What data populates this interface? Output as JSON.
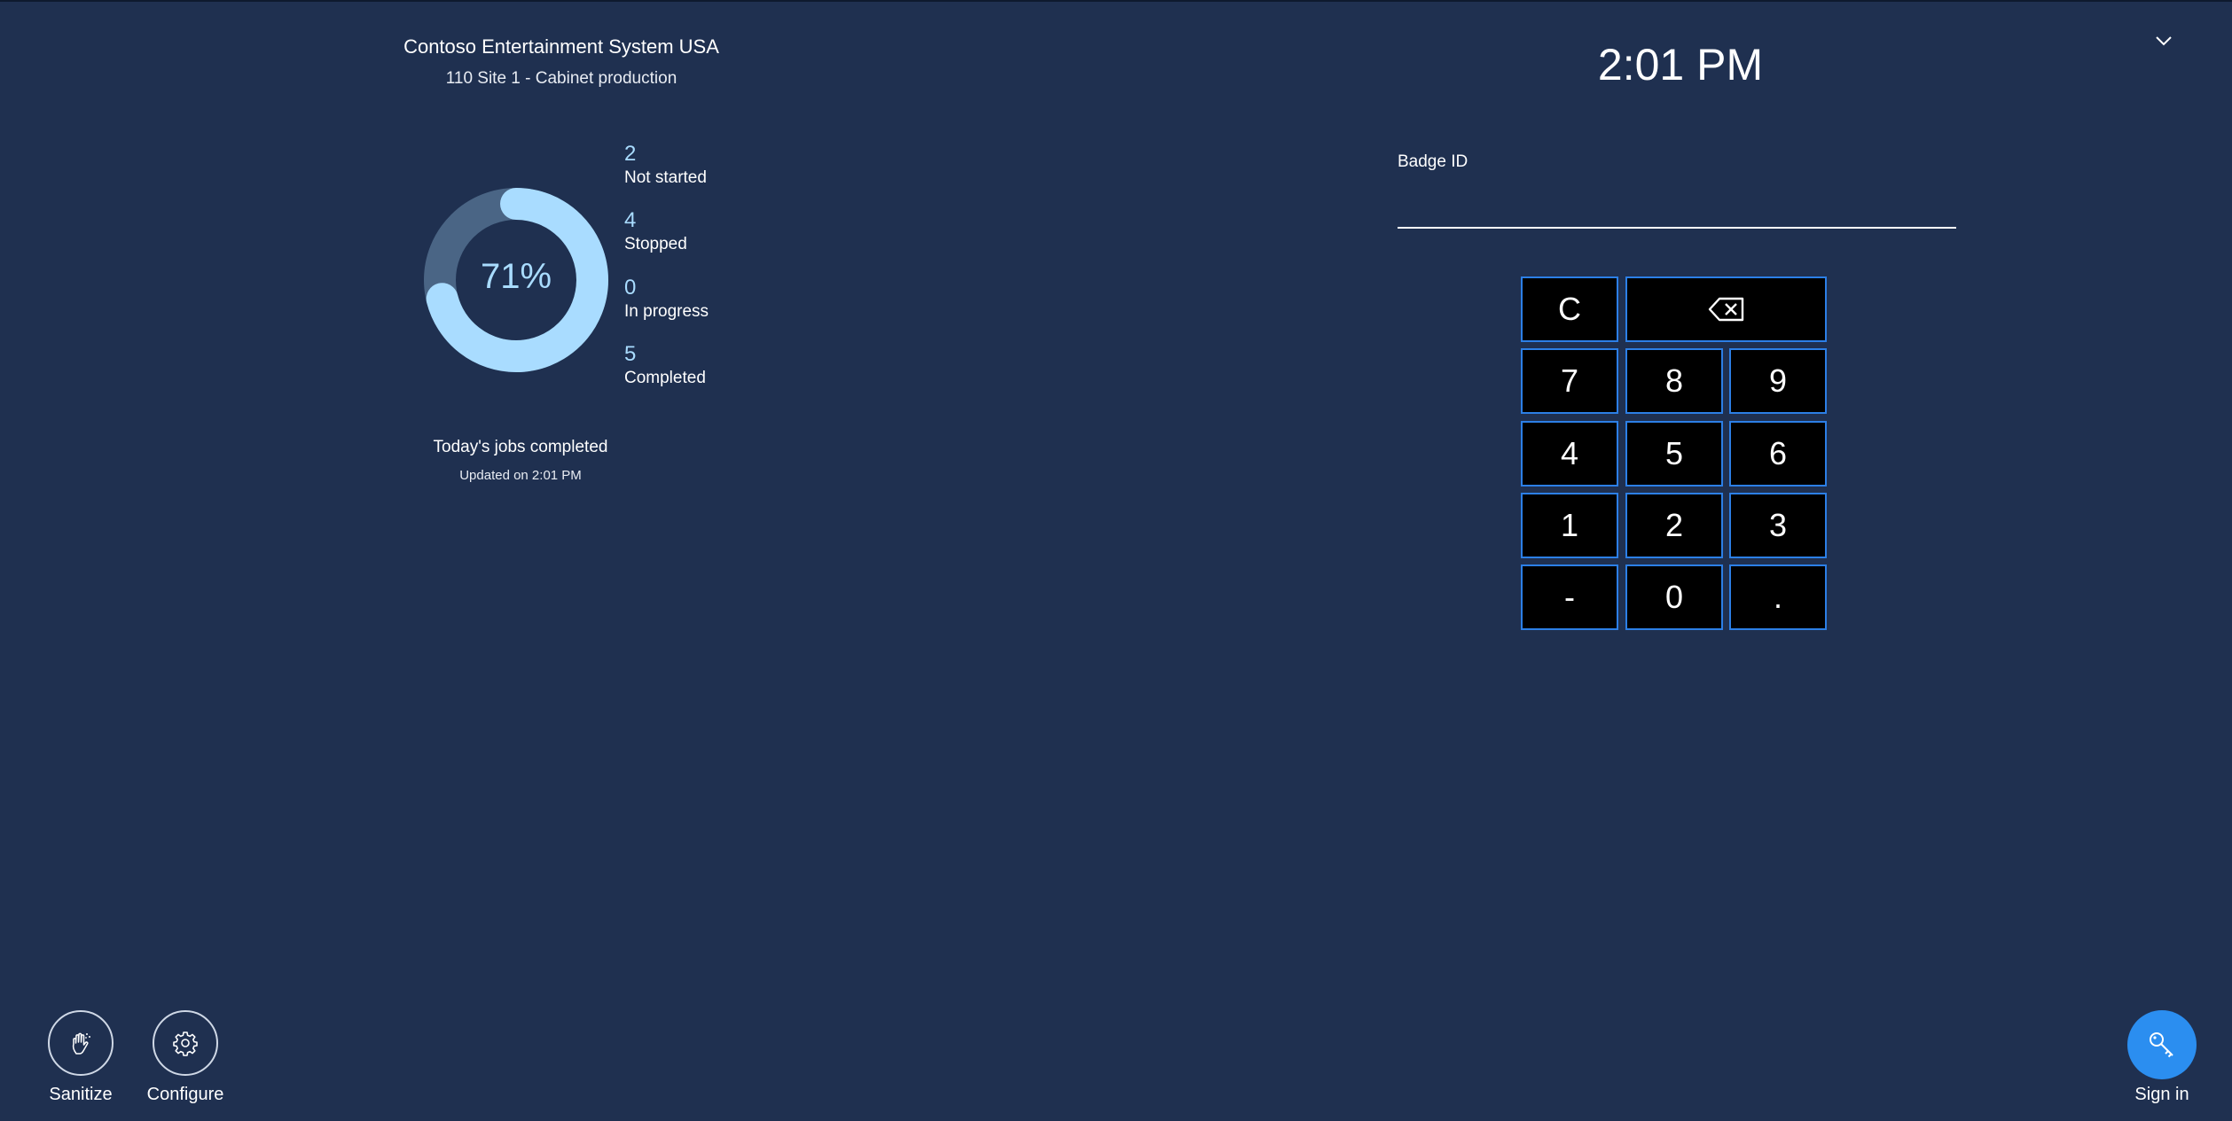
{
  "header": {
    "company": "Contoso Entertainment System USA",
    "site": "110 Site 1 - Cabinet production",
    "time": "2:01 PM"
  },
  "summary": {
    "percent_label": "71%",
    "percent_complete": 0.71,
    "stats": [
      {
        "count": "2",
        "label": "Not started"
      },
      {
        "count": "4",
        "label": "Stopped"
      },
      {
        "count": "0",
        "label": "In progress"
      },
      {
        "count": "5",
        "label": "Completed"
      }
    ],
    "title": "Today's jobs completed",
    "updated": "Updated on 2:01 PM"
  },
  "badge": {
    "label": "Badge ID",
    "value": ""
  },
  "keypad": {
    "clear": "C",
    "backspace_icon": "backspace-icon",
    "keys": [
      "7",
      "8",
      "9",
      "4",
      "5",
      "6",
      "1",
      "2",
      "3",
      "-",
      "0",
      "."
    ]
  },
  "footer": {
    "sanitize_label": "Sanitize",
    "configure_label": "Configure",
    "signin_label": "Sign in",
    "sanitize_icon": "hand-sanitize-icon",
    "configure_icon": "gear-icon",
    "signin_icon": "key-icon"
  },
  "colors": {
    "background": "#1f3050",
    "accent": "#2b8ef0",
    "donut_fill": "#a9dcff",
    "donut_track": "#4a6585",
    "key_border": "#2c7fe6"
  }
}
